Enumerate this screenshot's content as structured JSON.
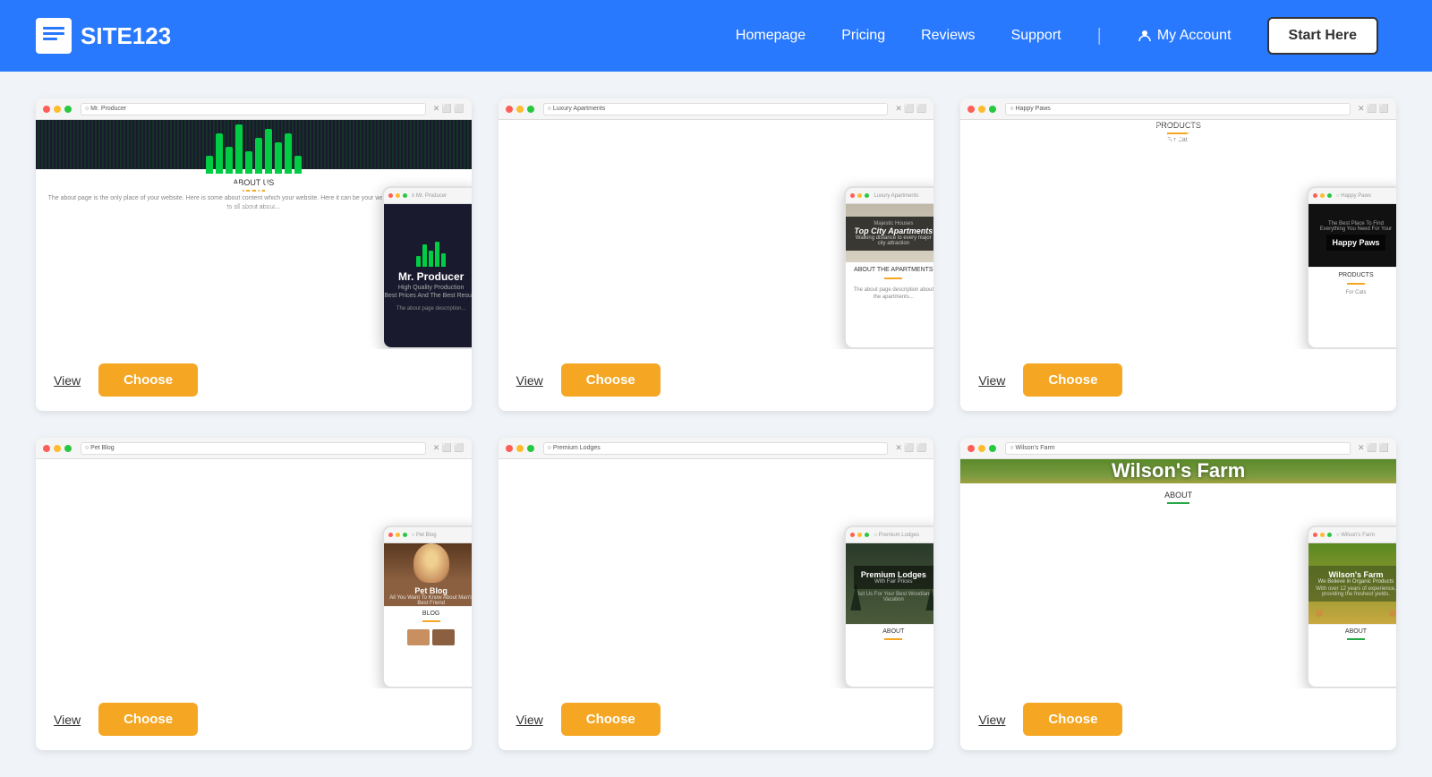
{
  "header": {
    "logo_text": "SITE123",
    "nav": {
      "homepage": "Homepage",
      "pricing": "Pricing",
      "reviews": "Reviews",
      "support": "Support",
      "my_account": "My Account",
      "start_here": "Start Here"
    }
  },
  "templates": [
    {
      "id": "mr-producer",
      "title": "Mr. Producer",
      "subtitle": "High Quality Production",
      "sub2": "Best Prices And The Best Results",
      "about_label": "ABOUT US",
      "view_label": "View",
      "choose_label": "Choose",
      "browser_url": "Mr. Producer"
    },
    {
      "id": "luxury-apartments",
      "title": "Top City Apartments",
      "subtitle": "Majestic Houses",
      "sub2": "Walking distance to every major city attraction",
      "about_label": "ABOUT THE APARTMENTS",
      "view_label": "View",
      "choose_label": "Choose",
      "browser_url": "Luxury Apartments"
    },
    {
      "id": "happy-paws",
      "title": "Happy Paws",
      "subtitle": "The Best Place To Find Everything You Need For Your",
      "sub2": "Happy Paws",
      "about_label": "PRODUCTS",
      "view_label": "View",
      "choose_label": "Choose",
      "browser_url": "Happy Paws"
    },
    {
      "id": "pet-blog",
      "title": "Pet Blog",
      "subtitle": "All You Want To Know About Man's Best Friend",
      "about_label": "BLOG",
      "view_label": "View",
      "choose_label": "Choose",
      "browser_url": "Pet Blog"
    },
    {
      "id": "premium-lodges",
      "title": "Premium Lodges",
      "subtitle": "With Fair Prices",
      "sub2": "Visit Us For Your Best Woodland Vacation",
      "about_label": "ABOUT",
      "view_label": "View",
      "choose_label": "Choose",
      "browser_url": "Premium Lodges"
    },
    {
      "id": "wilsons-farm",
      "title": "Wilson's Farm",
      "subtitle": "We Believe in Organic Products",
      "sub2": "With over 12 years of experience, providing the freshest yields.",
      "about_label": "ABOUT",
      "view_label": "View",
      "choose_label": "Choose",
      "browser_url": "Wilson's Farm"
    }
  ],
  "colors": {
    "header_bg": "#2979ff",
    "choose_btn": "#f5a623",
    "orange_accent": "#f5a623"
  }
}
